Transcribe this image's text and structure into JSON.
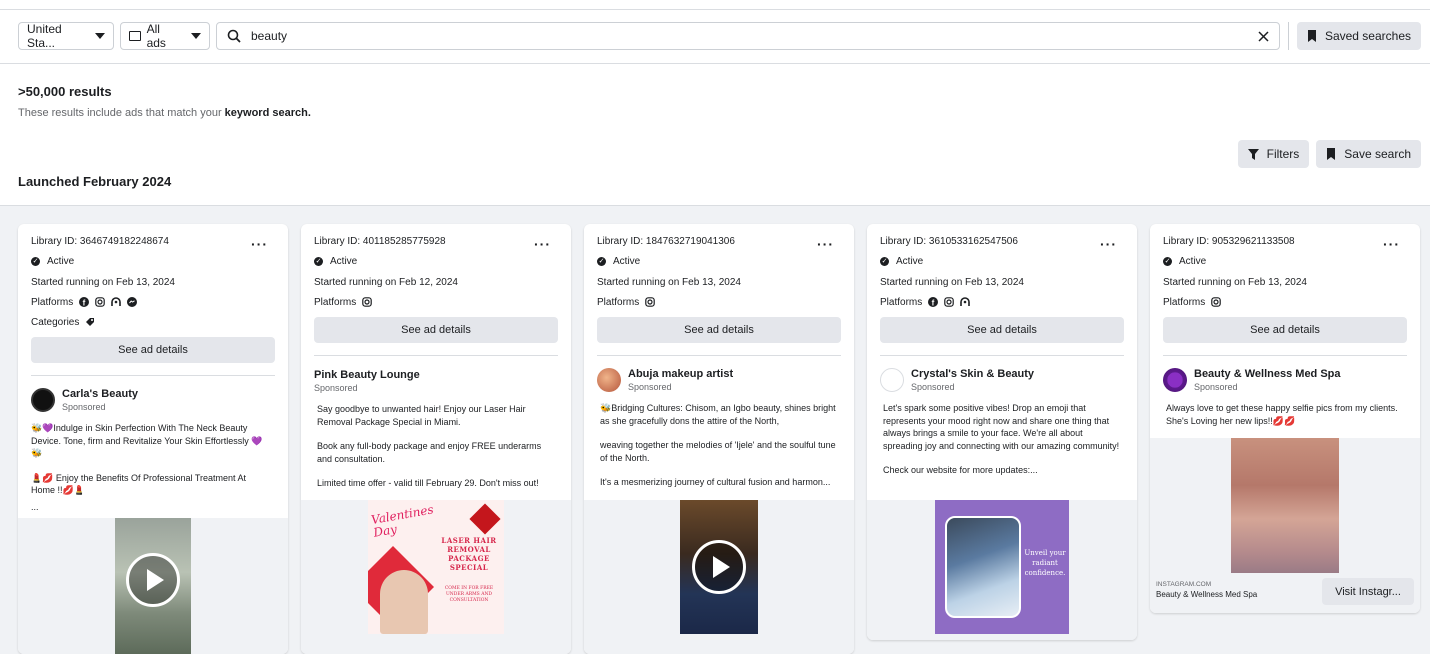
{
  "search": {
    "country": "United Sta...",
    "ad_type": "All ads",
    "query": "beauty",
    "saved_searches": "Saved searches"
  },
  "results": {
    "count": ">50,000 results",
    "subtitle_prefix": "These results include ads that match your ",
    "subtitle_bold": "keyword search.",
    "filters": "Filters",
    "save_search": "Save search",
    "launched": "Launched February 2024"
  },
  "labels": {
    "active": "Active",
    "platforms": "Platforms",
    "categories": "Categories",
    "see_details": "See ad details",
    "sponsored": "Sponsored"
  },
  "cards": [
    {
      "library_id": "Library ID: 3646749182248674",
      "started": "Started running on Feb 13, 2024",
      "advertiser": "Carla's Beauty",
      "body1": "🐝💜Indulge in Skin Perfection With The Neck Beauty Device. Tone, firm and Revitalize Your Skin Effortlessly 💜🐝",
      "body2": "💄💋 Enjoy the Benefits Of Professional Treatment At Home !!💋💄",
      "body3": "..."
    },
    {
      "library_id": "Library ID: 401185285775928",
      "started": "Started running on Feb 12, 2024",
      "advertiser": "Pink Beauty Lounge",
      "body1": "Say goodbye to unwanted hair! Enjoy our Laser Hair Removal Package Special in Miami.",
      "body2": "Book any full-body package and enjoy FREE underarms and consultation.",
      "body3": "Limited time offer - valid till February 29. Don't miss out!",
      "img_title": "Valentines Day",
      "img_text": "LASER HAIR REMOVAL PACKAGE SPECIAL",
      "img_sub": "COME IN FOR FREE UNDER ARMS AND CONSULTATION"
    },
    {
      "library_id": "Library ID: 1847632719041306",
      "started": "Started running on Feb 13, 2024",
      "advertiser": "Abuja makeup artist",
      "body1": "🐝Bridging Cultures: Chisom, an Igbo beauty, shines bright as she gracefully dons the attire of the North,",
      "body2": "weaving together the melodies of 'Ijele' and the soulful tune of the North.",
      "body3": "It's a mesmerizing journey of cultural fusion and harmon..."
    },
    {
      "library_id": "Library ID: 3610533162547506",
      "started": "Started running on Feb 13, 2024",
      "advertiser": "Crystal's Skin & Beauty",
      "body1": "Let's spark some positive vibes! Drop an emoji that represents your mood right now and share one thing that always brings a smile to your face. We're all about spreading joy and connecting with our amazing community!",
      "body2": "Check our website for more updates:...",
      "img_text": "Unveil your radiant confidence."
    },
    {
      "library_id": "Library ID: 905329621133508",
      "started": "Started running on Feb 13, 2024",
      "advertiser": "Beauty & Wellness Med Spa",
      "body1": "Always love to get these happy selfie pics from my clients. She's Loving her new lips!!💋💋",
      "link_domain": "INSTAGRAM.COM",
      "link_name": "Beauty & Wellness Med Spa",
      "cta": "Visit Instagr..."
    }
  ]
}
